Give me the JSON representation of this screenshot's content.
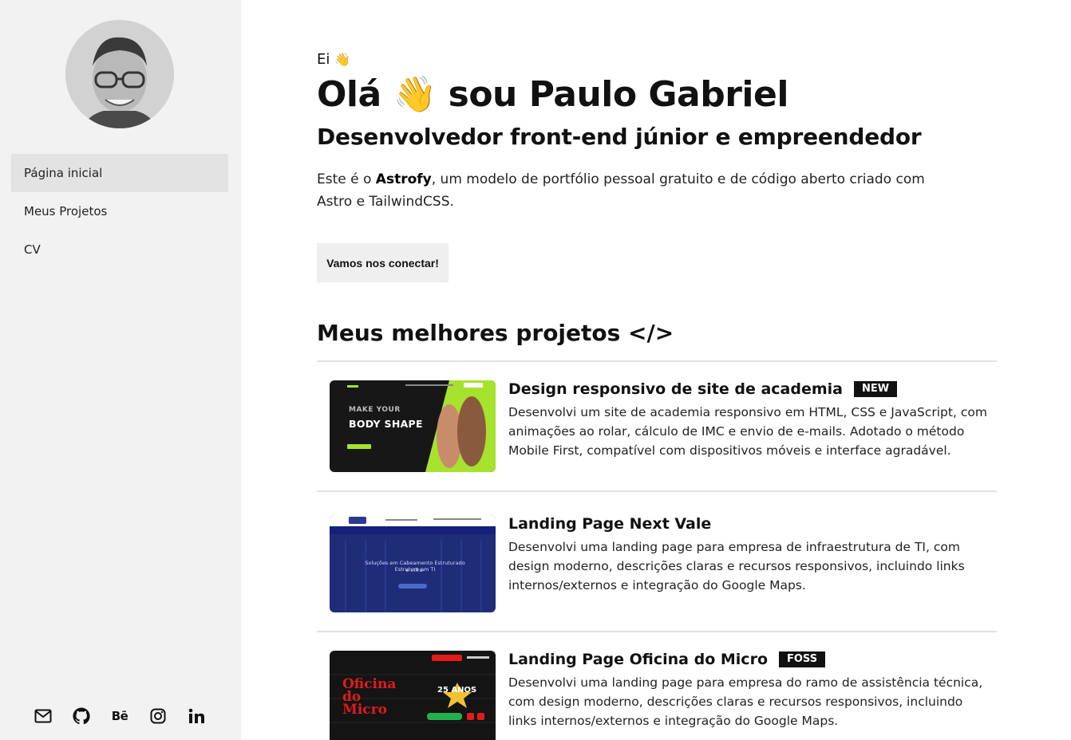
{
  "sidebar": {
    "nav": [
      {
        "label": "Página inicial",
        "active": true
      },
      {
        "label": "Meus Projetos",
        "active": false
      },
      {
        "label": "CV",
        "active": false
      }
    ],
    "socials": [
      "mail-icon",
      "github-icon",
      "behance-icon",
      "instagram-icon",
      "linkedin-icon"
    ],
    "behance_text": "Bē"
  },
  "hero": {
    "small_greeting": "Ei",
    "title_part1": "Olá",
    "title_part2": "sou Paulo Gabriel",
    "wave_emoji": "👋",
    "subtitle": "Desenvolvedor front-end júnior e empreendedor",
    "desc_prefix": "Este é o ",
    "desc_bold": "Astrofy",
    "desc_suffix": ", um modelo de portfólio pessoal gratuito e de código aberto criado com Astro e TailwindCSS.",
    "connect_label": "Vamos nos conectar!"
  },
  "projects_section": {
    "title": "Meus melhores projetos </>",
    "items": [
      {
        "title": "Design responsivo de site de academia",
        "badge": "NEW",
        "desc": "Desenvolvi um site de academia responsivo em HTML, CSS e JavaScript, com animações ao rolar, cálculo de IMC e envio de e-mails. Adotado o método Mobile First, compatível com dispositivos móveis e interface agradável.",
        "thumb_text1": "MAKE YOUR",
        "thumb_text2": "BODY SHAPE"
      },
      {
        "title": "Landing Page Next Vale",
        "badge": "",
        "desc": "Desenvolvi uma landing page para empresa de infraestrutura de TI, com design moderno, descrições claras e recursos responsivos, incluindo links internos/externos e integração do Google Maps.",
        "thumb_text1": "Soluções em Cabeamento Estruturado e Infra-",
        "thumb_text2": "Estrutura em TI"
      },
      {
        "title": "Landing Page Oficina do Micro",
        "badge": "FOSS",
        "desc": "Desenvolvi uma landing page para empresa do ramo de assistência técnica, com design moderno, descrições claras e recursos responsivos, incluindo links internos/externos e integração do Google Maps.",
        "thumb_text1": "Oficina do Micro",
        "thumb_text2": "25 ANOS"
      }
    ]
  }
}
